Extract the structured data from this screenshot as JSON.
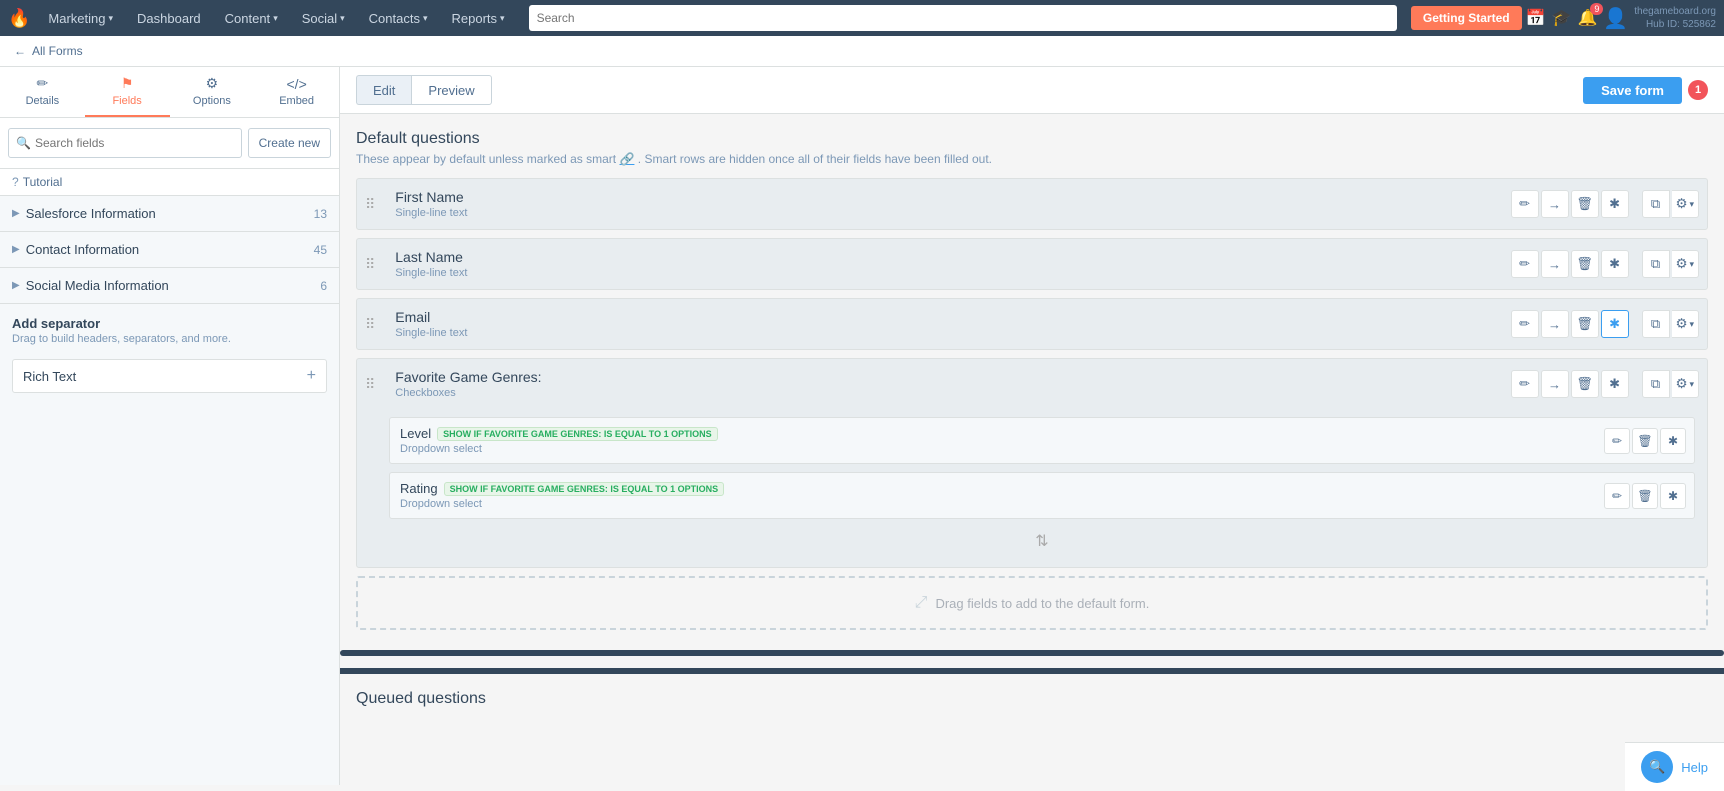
{
  "app": {
    "logo": "🔥",
    "brand": "Marketing",
    "domain": "thegameboard.org",
    "hub_id": "Hub ID: 525862"
  },
  "nav": {
    "items": [
      {
        "label": "Marketing",
        "caret": true
      },
      {
        "label": "Dashboard",
        "caret": false
      },
      {
        "label": "Content",
        "caret": true
      },
      {
        "label": "Social",
        "caret": true
      },
      {
        "label": "Contacts",
        "caret": true
      },
      {
        "label": "Reports",
        "caret": true
      }
    ],
    "search_placeholder": "Search",
    "getting_started": "Getting Started",
    "notification_count": "9"
  },
  "breadcrumb": {
    "parent": "All Forms",
    "arrow": "←"
  },
  "sidebar": {
    "tabs": [
      {
        "label": "Details",
        "icon": "✏️",
        "active": false
      },
      {
        "label": "Fields",
        "icon": "🚩",
        "active": true
      },
      {
        "label": "Options",
        "icon": "⚙️",
        "active": false
      },
      {
        "label": "Embed",
        "icon": "</>",
        "active": false
      }
    ],
    "search_placeholder": "Search fields",
    "create_new": "Create new",
    "sections": [
      {
        "label": "Salesforce Information",
        "count": "13"
      },
      {
        "label": "Contact Information",
        "count": "45"
      },
      {
        "label": "Social Media Information",
        "count": "6"
      }
    ],
    "add_separator": {
      "title": "Add separator",
      "desc": "Drag to build headers, separators, and more."
    },
    "rich_text": "Rich Text",
    "tutorial": "Tutorial"
  },
  "form_header": {
    "edit": "Edit",
    "preview": "Preview",
    "save": "Save form",
    "save_badge": "1"
  },
  "default_questions": {
    "title": "Default questions",
    "subtitle": "These appear by default unless marked as smart",
    "subtitle2": ". Smart rows are hidden once all of their fields have been filled out."
  },
  "fields": [
    {
      "name": "First Name",
      "type": "Single-line text",
      "star_active": false
    },
    {
      "name": "Last Name",
      "type": "Single-line text",
      "star_active": false
    },
    {
      "name": "Email",
      "type": "Single-line text",
      "star_active": true
    },
    {
      "name": "Favorite Game Genres:",
      "type": "Checkboxes",
      "star_active": false,
      "nested": [
        {
          "name": "Level",
          "badge": "SHOW IF FAVORITE GAME GENRES: IS EQUAL TO 1 OPTIONS",
          "type": "Dropdown select"
        },
        {
          "name": "Rating",
          "badge": "SHOW IF FAVORITE GAME GENRES: IS EQUAL TO 1 OPTIONS",
          "type": "Dropdown select"
        }
      ]
    }
  ],
  "drag_target": {
    "text": "Drag fields to add to the default form."
  },
  "queued": {
    "title": "Queued questions"
  },
  "help": {
    "label": "Help"
  }
}
